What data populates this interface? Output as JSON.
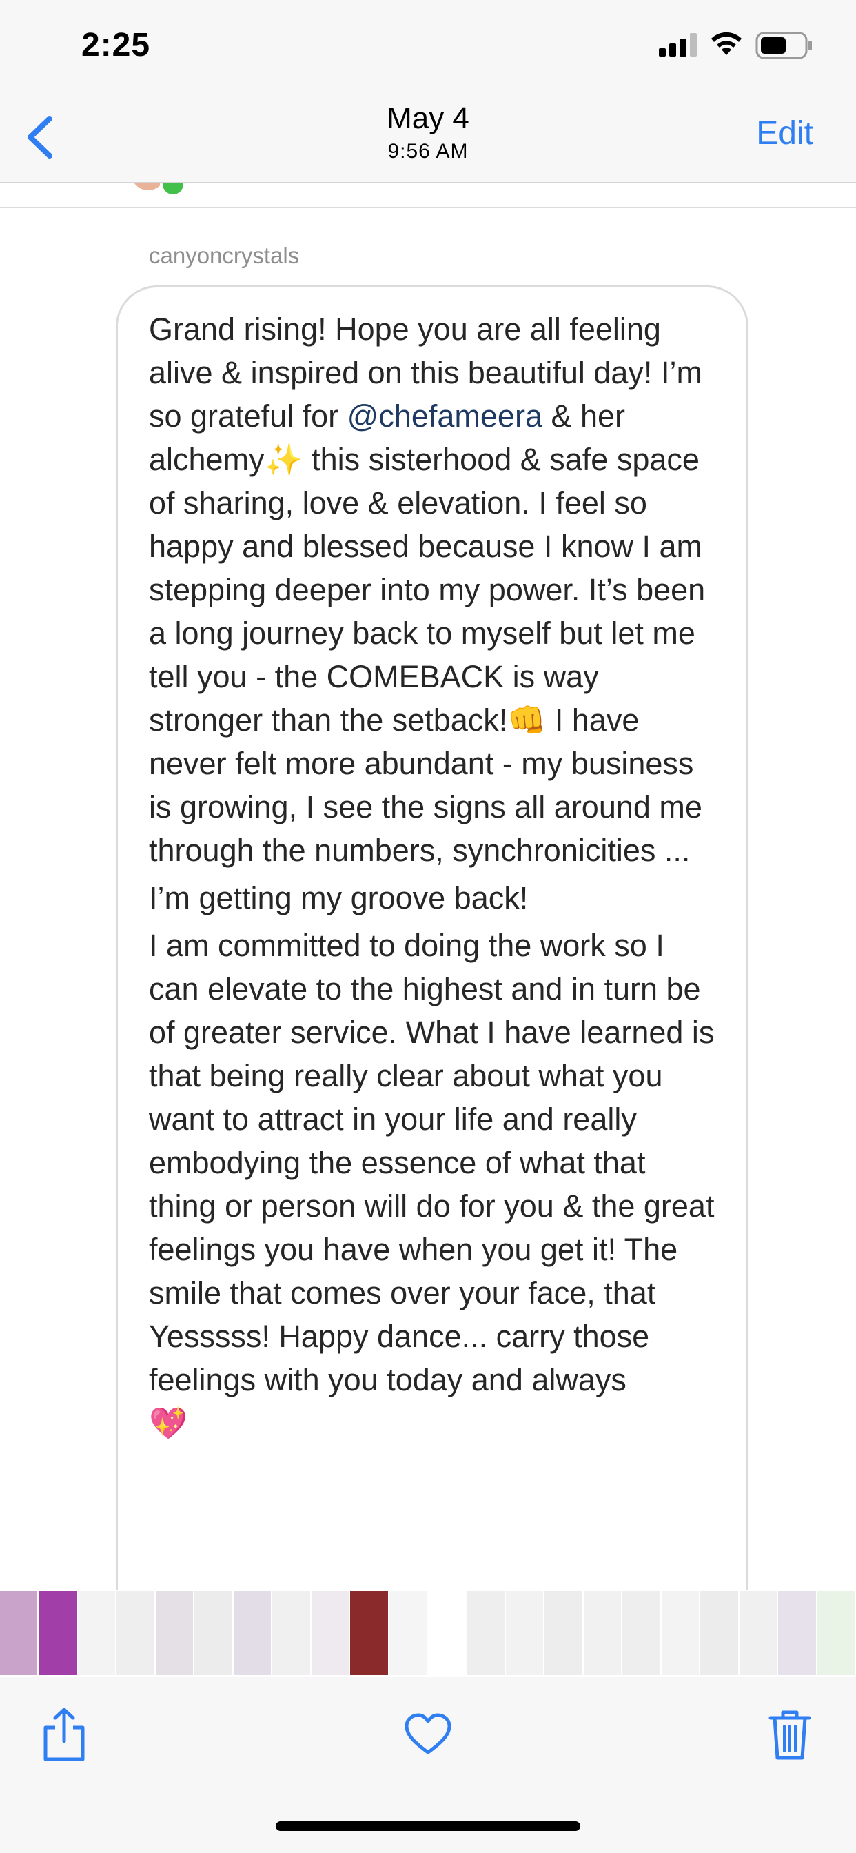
{
  "status_bar": {
    "time": "2:25"
  },
  "header": {
    "date": "May 4",
    "time": "9:56 AM",
    "edit_label": "Edit"
  },
  "post": {
    "sender": "canyoncrystals",
    "segments": [
      {
        "text": "Grand rising! Hope you are all feeling alive & inspired on this beautiful day! I’m so grateful for "
      },
      {
        "text": "@chefameera",
        "mention": true
      },
      {
        "text": " & her alchemy"
      },
      {
        "text": "✨",
        "emoji": true
      },
      {
        "text": " this sisterhood & safe space of sharing, love & elevation. I feel so happy and blessed because I know I am stepping deeper into my power. It’s been a long journey back to myself but let me tell you - the COMEBACK is way stronger than the setback!"
      },
      {
        "text": "👊",
        "emoji": true
      },
      {
        "text": " I have never felt more abundant - my business is growing, I see the signs all around me through the numbers, synchronicities ..."
      }
    ],
    "paragraph_2": "I’m getting my groove back!",
    "paragraph_3": "I am committed to doing the work so I can elevate to the highest and in turn be of greater service. What I have learned is that being really clear about what you want to attract in your life and really embodying the essence of what that thing or person will do for you & the great feelings you have when you get it! The smile that comes over your face, that Yesssss! Happy dance... carry those feelings with you today and always",
    "end_emoji": "💖"
  },
  "thumbnails": {
    "count": 22,
    "colors": [
      "#c9a3c9",
      "#a23ea8",
      "#f3f3f3",
      "#eeeeee",
      "#e5e0e6",
      "#ececec",
      "#e3dde8",
      "#f0f0f0",
      "#efeaef",
      "#8a2a2a",
      "#f5f5f5",
      "#ffffff",
      "#eeeeee",
      "#f2f2f2",
      "#ededed",
      "#f1f1f1",
      "#eeeeee",
      "#f3f3f3",
      "#ececec",
      "#f0f0f0",
      "#e6e1ea",
      "#e9f3e6"
    ]
  },
  "toolbar": {
    "icons": [
      "share-icon",
      "heart-icon",
      "trash-icon"
    ],
    "accent_color": "#2f7ef2"
  }
}
